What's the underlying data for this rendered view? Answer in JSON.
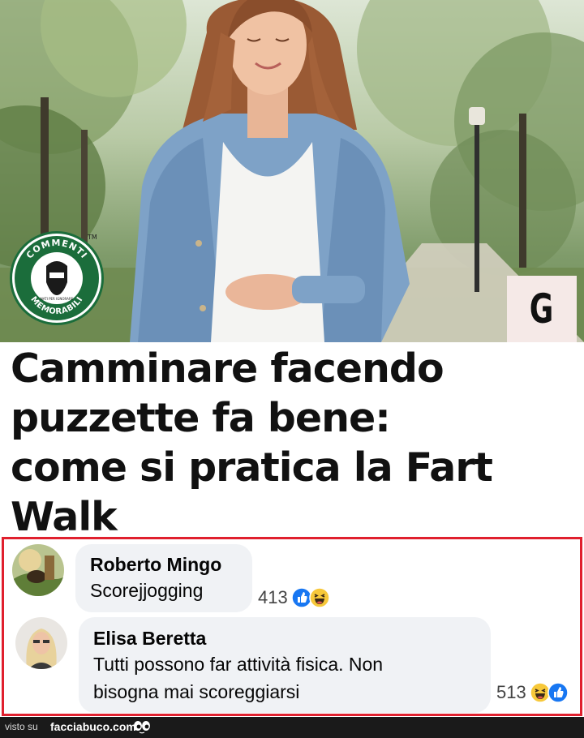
{
  "hero": {
    "image_description_icon": "woman-walking-park-photo",
    "logo": {
      "ring_text_top": "COMMENTI",
      "ring_text_bottom": "MEMORABILI",
      "inner_text": "NATI PER IGNORARE",
      "tm": "TM"
    },
    "badge": {
      "letter": "G"
    }
  },
  "headline": {
    "lines": [
      "Camminare facendo",
      "puzzette fa bene:",
      "come si pratica la Fart",
      "Walk"
    ]
  },
  "comments": [
    {
      "author": "Roberto Mingo",
      "text_lines": [
        "Scorejjogging"
      ],
      "reaction_count": "413",
      "reactions": [
        "like-icon",
        "haha-icon"
      ]
    },
    {
      "author": "Elisa Beretta",
      "text_lines": [
        "Tutti possono far attività fisica. Non",
        "bisogna mai scoreggiarsi"
      ],
      "reaction_count": "513",
      "reactions": [
        "haha-icon",
        "like-icon"
      ]
    }
  ],
  "footer": {
    "visto_su": "visto su",
    "site": "facciabuco.com"
  },
  "colors": {
    "frame_red": "#e0202e",
    "logo_green": "#1b6d3b",
    "like_blue": "#1877f2",
    "bubble_gray": "#f0f2f5"
  }
}
